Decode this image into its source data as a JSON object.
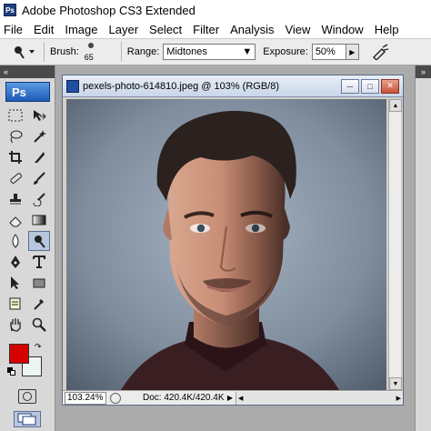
{
  "window": {
    "title": "Adobe Photoshop CS3 Extended"
  },
  "menu": [
    "File",
    "Edit",
    "Image",
    "Layer",
    "Select",
    "Filter",
    "Analysis",
    "View",
    "Window",
    "Help"
  ],
  "options": {
    "brush_label": "Brush:",
    "brush_size": "65",
    "range_label": "Range:",
    "range_value": "Midtones",
    "exposure_label": "Exposure:",
    "exposure_value": "50%"
  },
  "toolbox": {
    "logo": "Ps",
    "foreground_color": "#d50000",
    "background_color": "#eef4ef",
    "active_tool": "burn-tool"
  },
  "document": {
    "title": "pexels-photo-614810.jpeg @ 103% (RGB/8)",
    "zoom": "103.24%",
    "doc_info": "Doc: 420.4K/420.4K"
  }
}
